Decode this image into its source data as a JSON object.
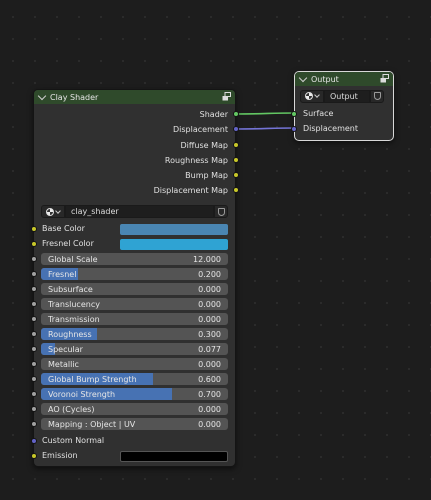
{
  "clay_node": {
    "title": "Clay Shader",
    "outputs": [
      "Shader",
      "Displacement",
      "Diffuse Map",
      "Roughness Map",
      "Bump Map",
      "Displacement Map"
    ],
    "material_name": "clay_shader",
    "color_inputs": [
      {
        "label": "Base Color",
        "color": "#4a86b3"
      },
      {
        "label": "Fresnel Color",
        "color": "#2fa3d3"
      }
    ],
    "sliders": [
      {
        "label": "Global Scale",
        "value": "12.000",
        "fraction": 0
      },
      {
        "label": "Fresnel",
        "value": "0.200",
        "fraction": 0.2
      },
      {
        "label": "Subsurface",
        "value": "0.000",
        "fraction": 0
      },
      {
        "label": "Translucency",
        "value": "0.000",
        "fraction": 0
      },
      {
        "label": "Transmission",
        "value": "0.000",
        "fraction": 0
      },
      {
        "label": "Roughness",
        "value": "0.300",
        "fraction": 0.3
      },
      {
        "label": "Specular",
        "value": "0.077",
        "fraction": 0.077
      },
      {
        "label": "Metallic",
        "value": "0.000",
        "fraction": 0
      },
      {
        "label": "Global Bump Strength",
        "value": "0.600",
        "fraction": 0.6
      },
      {
        "label": "Voronoi Strength",
        "value": "0.700",
        "fraction": 0.7
      },
      {
        "label": "AO (Cycles)",
        "value": "0.000",
        "fraction": 0
      },
      {
        "label": "Mapping : Object | UV",
        "value": "0.000",
        "fraction": 0
      }
    ],
    "custom_normal_label": "Custom Normal",
    "emission": {
      "label": "Emission",
      "color": "#000000"
    }
  },
  "output_node": {
    "title": "Output",
    "target": "Output",
    "inputs": [
      "Surface",
      "Displacement"
    ]
  }
}
